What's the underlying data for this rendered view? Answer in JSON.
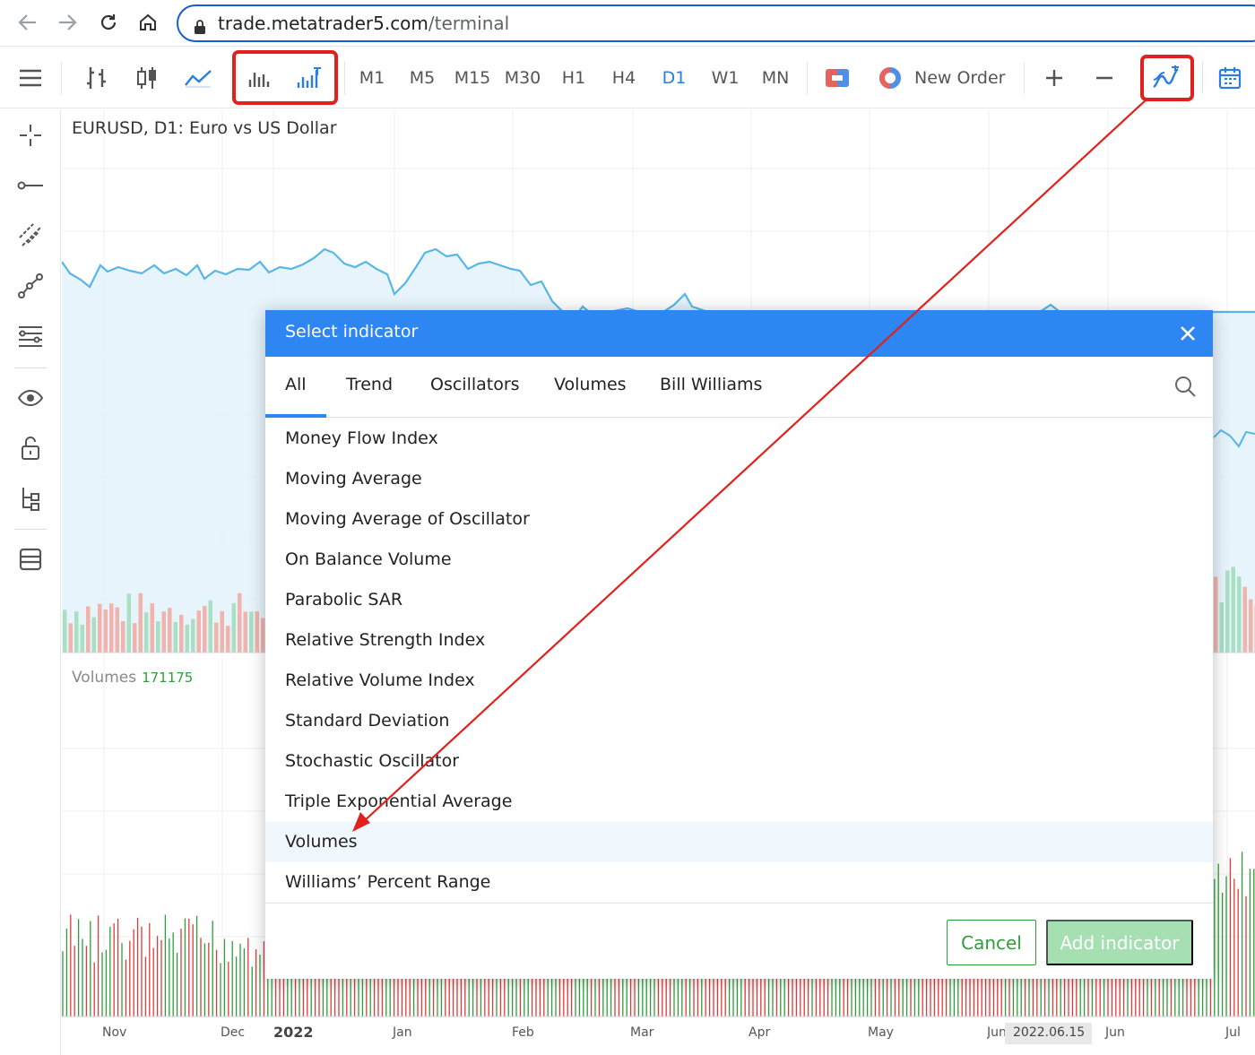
{
  "browser": {
    "url_host": "trade.metatrader5.com",
    "url_path": "/terminal"
  },
  "toolbar": {
    "timeframes": [
      "M1",
      "M5",
      "M15",
      "M30",
      "H1",
      "H4",
      "D1",
      "W1",
      "MN"
    ],
    "active_timeframe": "D1",
    "new_order_label": "New Order",
    "icons": [
      "menu-icon",
      "bar-chart-icon",
      "candlestick-icon",
      "line-chart-icon",
      "tick-volume-icon",
      "real-volume-icon",
      "one-click-trading-icon",
      "new-order-icon",
      "zoom-in-icon",
      "zoom-out-icon",
      "indicators-icon",
      "calendar-icon"
    ],
    "accent": "#2a7de1"
  },
  "sidebar": {
    "icons": [
      "crosshair-icon",
      "horizontal-line-icon",
      "trendline-icon",
      "polyline-icon",
      "fibonacci-icon",
      "eye-icon",
      "lock-icon",
      "objects-tree-icon",
      "layers-icon"
    ]
  },
  "chart": {
    "title": "EURUSD, D1: Euro vs US Dollar",
    "volumes_label": "Volumes",
    "volumes_value": "171175",
    "x_labels": [
      "Nov",
      "Dec",
      "2022",
      "Jan",
      "Feb",
      "Mar",
      "Apr",
      "May",
      "Jun",
      "2022.06.15",
      "Jun",
      "Jul"
    ],
    "colors": {
      "line": "#58b6e6",
      "bull": "#2e9e3b",
      "bear": "#e03a3a"
    }
  },
  "dialog": {
    "title": "Select indicator",
    "tabs": [
      "All",
      "Trend",
      "Oscillators",
      "Volumes",
      "Bill Williams"
    ],
    "active_tab": "All",
    "items": [
      "Money Flow Index",
      "Moving Average",
      "Moving Average of Oscillator",
      "On Balance Volume",
      "Parabolic SAR",
      "Relative Strength Index",
      "Relative Volume Index",
      "Standard Deviation",
      "Stochastic Oscillator",
      "Triple Exponential Average",
      "Volumes",
      "Williams’ Percent Range"
    ],
    "selected_item": "Volumes",
    "cancel_label": "Cancel",
    "add_label": "Add indicator",
    "header_color": "#2e86f2"
  },
  "annotation": {
    "highlight_color": "#e0211c"
  }
}
